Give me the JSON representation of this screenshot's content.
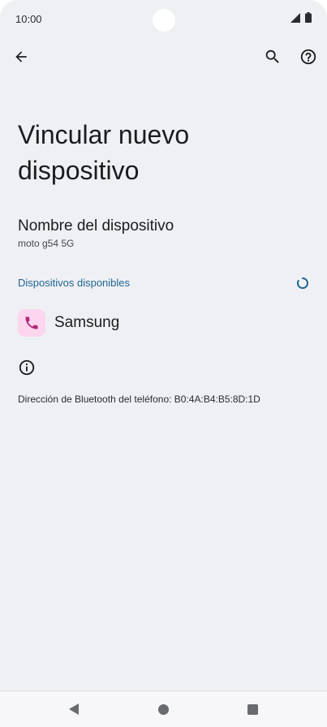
{
  "status_bar": {
    "time": "10:00"
  },
  "app_bar": {
    "back_icon": "arrow-back-icon",
    "search_icon": "search-icon",
    "help_icon": "help-icon"
  },
  "page": {
    "title": "Vincular nuevo dispositivo",
    "device_name_label": "Nombre del dispositivo",
    "device_name_value": "moto g54 5G",
    "available_section": "Dispositivos disponibles",
    "devices": [
      {
        "label": "Samsung",
        "icon": "phone-icon"
      }
    ],
    "bluetooth_address": "Dirección de Bluetooth del teléfono: B0:4A:B4:B5:8D:1D"
  },
  "colors": {
    "background": "#eff0f3",
    "accent": "#1f6593",
    "device_icon_bg": "#fbd6ee",
    "device_icon_fg": "#b0287a"
  }
}
